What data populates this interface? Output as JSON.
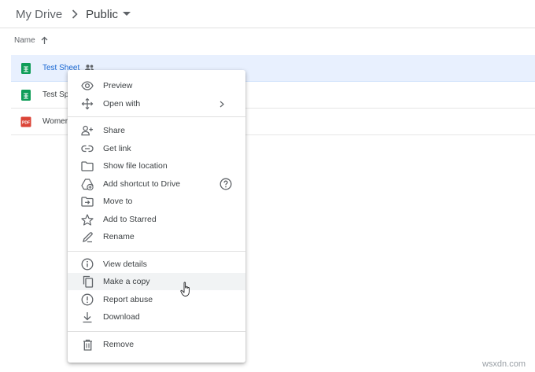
{
  "breadcrumb": {
    "root": "My Drive",
    "current": "Public"
  },
  "list": {
    "header_name": "Name"
  },
  "files": [
    {
      "name": "Test Sheet",
      "type": "sheet",
      "selected": true,
      "shared": true
    },
    {
      "name": "Test Sp",
      "type": "sheet",
      "selected": false,
      "shared": false
    },
    {
      "name": "Women",
      "type": "pdf",
      "selected": false,
      "shared": false
    }
  ],
  "pdf_badge": "PDF",
  "menu": {
    "items": [
      {
        "label": "Preview",
        "icon": "eye-icon"
      },
      {
        "label": "Open with",
        "icon": "move-arrows-icon",
        "submenu": true
      },
      {
        "label": "Share",
        "icon": "person-add-icon"
      },
      {
        "label": "Get link",
        "icon": "link-icon"
      },
      {
        "label": "Show file location",
        "icon": "folder-icon"
      },
      {
        "label": "Add shortcut to Drive",
        "icon": "add-shortcut-icon",
        "help": true
      },
      {
        "label": "Move to",
        "icon": "move-to-folder-icon"
      },
      {
        "label": "Add to Starred",
        "icon": "star-icon"
      },
      {
        "label": "Rename",
        "icon": "pencil-icon"
      },
      {
        "label": "View details",
        "icon": "info-icon"
      },
      {
        "label": "Make a copy",
        "icon": "copy-icon",
        "hover": true
      },
      {
        "label": "Report abuse",
        "icon": "alert-icon"
      },
      {
        "label": "Download",
        "icon": "download-icon"
      },
      {
        "label": "Remove",
        "icon": "trash-icon"
      }
    ]
  },
  "watermark": "wsxdn.com",
  "colors": {
    "sheets_green": "#0f9d58",
    "pdf_red": "#db4437",
    "selection": "#e8f0fe",
    "hover": "#f1f3f4"
  }
}
